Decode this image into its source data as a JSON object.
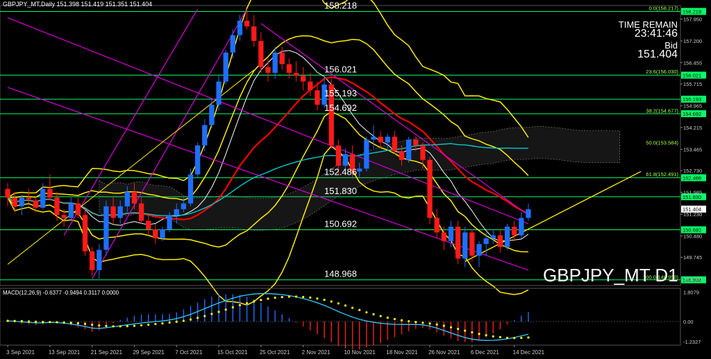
{
  "header": {
    "ohlc_text": "GBPJPY_MT,Daily  151.398 151.419 151.351 151.404"
  },
  "info": {
    "time_remain_label": "TIME REMAIN",
    "time_remain": "23:41:46",
    "bid_label": "Bid",
    "bid_value": "151.404"
  },
  "symbol_label": "GBPJPY_MT D1",
  "colors": {
    "bull": "#1e6fff",
    "bear": "#ff1a1a",
    "level": "#00ff66",
    "bollinger": "#ffee00",
    "channel": "#cc00cc",
    "ma_red": "#ff0000",
    "ma_cyan": "#00cccc",
    "fib_text": "#a6ff4d",
    "macd_signal": "#ffff00",
    "macd_line": "#33ccff"
  },
  "chart_data": {
    "type": "candlestick",
    "price_range": [
      148.77,
      158.42
    ],
    "y_ticks": [
      "157.950",
      "157.200",
      "156.455",
      "155.715",
      "154.965",
      "154.215",
      "153.465",
      "152.730",
      "151.985",
      "151.230",
      "150.480",
      "149.745",
      "149.000"
    ],
    "x_ticks": [
      "3 Sep 2021",
      "13 Sep 2021",
      "21 Sep 2021",
      "29 Sep 2021",
      "7 Oct 2021",
      "15 Oct 2021",
      "25 Oct 2021",
      "2 Nov 2021",
      "10 Nov 2021",
      "18 Nov 2021",
      "26 Nov 2021",
      "6 Dec 2021",
      "14 Dec 2021"
    ],
    "horizontal_levels": [
      {
        "value": 158.218,
        "label": "158.218",
        "axis_label": "158.218"
      },
      {
        "value": 156.021,
        "label": "156.021",
        "axis_label": "156.021"
      },
      {
        "value": 155.193,
        "label": "155.193",
        "axis_label": "155.193"
      },
      {
        "value": 154.692,
        "label": "154.692",
        "axis_label": "154.692"
      },
      {
        "value": 152.486,
        "label": "152.486",
        "axis_label": "152.486"
      },
      {
        "value": 151.83,
        "label": "151.830",
        "axis_label": "151.830"
      },
      {
        "value": 150.692,
        "label": "150.692",
        "axis_label": "150.692"
      },
      {
        "value": 148.968,
        "label": "148.968",
        "axis_label": "148.968"
      }
    ],
    "fib_levels": [
      {
        "value": 158.217,
        "label": "0.0(158.217)"
      },
      {
        "value": 156.03,
        "label": "23.6(156.030)"
      },
      {
        "value": 154.677,
        "label": "38.2(154.677)"
      },
      {
        "value": 153.584,
        "label": "50.0(153.584)"
      },
      {
        "value": 152.491,
        "label": "61.8(152.491)"
      },
      {
        "value": 148.95,
        "label": "100.0(148.950)"
      }
    ],
    "last_price": 151.404,
    "last_price_label": "151.404",
    "candles": [
      [
        152.1,
        152.3,
        151.5,
        151.8
      ],
      [
        151.8,
        152.0,
        151.3,
        151.5
      ],
      [
        151.5,
        151.9,
        151.2,
        151.8
      ],
      [
        151.8,
        152.1,
        151.6,
        151.75
      ],
      [
        151.7,
        151.85,
        151.3,
        151.45
      ],
      [
        151.45,
        152.3,
        151.4,
        152.1
      ],
      [
        152.1,
        152.6,
        151.7,
        151.8
      ],
      [
        151.8,
        152.0,
        151.0,
        151.2
      ],
      [
        151.2,
        151.4,
        150.8,
        151.1
      ],
      [
        151.1,
        151.8,
        151.0,
        151.6
      ],
      [
        151.6,
        151.8,
        151.1,
        151.2
      ],
      [
        151.2,
        151.4,
        149.8,
        149.95
      ],
      [
        149.95,
        150.1,
        149.1,
        149.3
      ],
      [
        149.3,
        150.2,
        149.0,
        150.0
      ],
      [
        150.0,
        151.7,
        149.8,
        151.5
      ],
      [
        151.5,
        151.8,
        150.9,
        151.1
      ],
      [
        151.1,
        151.7,
        150.9,
        151.5
      ],
      [
        151.5,
        152.2,
        151.3,
        152.0
      ],
      [
        152.0,
        152.3,
        151.4,
        151.6
      ],
      [
        151.6,
        151.8,
        150.9,
        151.0
      ],
      [
        151.0,
        151.2,
        150.5,
        150.7
      ],
      [
        150.7,
        150.9,
        150.2,
        150.4
      ],
      [
        150.4,
        150.8,
        150.3,
        150.7
      ],
      [
        150.7,
        151.3,
        150.6,
        151.2
      ],
      [
        151.2,
        151.6,
        150.9,
        151.4
      ],
      [
        151.4,
        151.8,
        151.3,
        151.6
      ],
      [
        151.6,
        152.8,
        151.5,
        152.6
      ],
      [
        152.6,
        153.7,
        152.5,
        153.6
      ],
      [
        153.6,
        154.5,
        153.4,
        154.3
      ],
      [
        154.3,
        155.2,
        154.2,
        155.0
      ],
      [
        155.0,
        156.0,
        154.8,
        155.8
      ],
      [
        155.8,
        156.9,
        155.7,
        156.8
      ],
      [
        156.8,
        157.6,
        156.6,
        157.4
      ],
      [
        157.4,
        158.1,
        157.2,
        157.9
      ],
      [
        157.9,
        158.3,
        157.6,
        157.7
      ],
      [
        157.7,
        158.1,
        157.0,
        157.2
      ],
      [
        157.2,
        157.5,
        156.1,
        156.3
      ],
      [
        156.3,
        156.6,
        155.8,
        156.1
      ],
      [
        156.1,
        157.0,
        155.9,
        156.8
      ],
      [
        156.8,
        157.0,
        156.2,
        156.4
      ],
      [
        156.4,
        156.6,
        155.9,
        156.1
      ],
      [
        156.1,
        156.5,
        155.8,
        156.0
      ],
      [
        156.0,
        156.3,
        155.5,
        155.8
      ],
      [
        155.8,
        156.1,
        155.3,
        155.5
      ],
      [
        155.5,
        155.8,
        154.8,
        155.0
      ],
      [
        155.0,
        156.0,
        154.9,
        155.7
      ],
      [
        155.7,
        155.9,
        153.5,
        153.6
      ],
      [
        153.6,
        153.8,
        152.6,
        152.9
      ],
      [
        152.9,
        153.5,
        152.7,
        153.3
      ],
      [
        153.3,
        153.6,
        152.5,
        152.7
      ],
      [
        152.7,
        153.0,
        152.5,
        152.8
      ],
      [
        152.8,
        153.9,
        152.7,
        153.8
      ],
      [
        153.8,
        154.3,
        153.5,
        153.9
      ],
      [
        153.9,
        154.1,
        153.5,
        153.7
      ],
      [
        153.7,
        154.0,
        153.5,
        153.9
      ],
      [
        153.9,
        154.1,
        153.3,
        153.4
      ],
      [
        153.4,
        153.6,
        152.9,
        153.1
      ],
      [
        153.1,
        153.9,
        153.0,
        153.8
      ],
      [
        153.8,
        153.9,
        153.4,
        153.6
      ],
      [
        153.6,
        153.7,
        152.8,
        153.1
      ],
      [
        153.1,
        153.2,
        150.9,
        151.1
      ],
      [
        151.1,
        151.4,
        150.4,
        150.6
      ],
      [
        150.6,
        150.8,
        150.0,
        150.3
      ],
      [
        150.3,
        151.0,
        150.1,
        150.8
      ],
      [
        150.8,
        151.0,
        149.5,
        149.7
      ],
      [
        149.7,
        150.8,
        149.4,
        150.6
      ],
      [
        150.6,
        150.7,
        149.6,
        149.8
      ],
      [
        149.8,
        150.3,
        149.4,
        150.2
      ],
      [
        150.2,
        150.6,
        149.8,
        150.4
      ],
      [
        150.4,
        150.7,
        150.2,
        150.5
      ],
      [
        150.5,
        150.7,
        149.9,
        150.1
      ],
      [
        150.1,
        150.9,
        150.0,
        150.8
      ],
      [
        150.8,
        151.0,
        150.3,
        150.5
      ],
      [
        150.5,
        151.3,
        150.4,
        151.1
      ],
      [
        151.1,
        151.6,
        151.0,
        151.4
      ]
    ],
    "macd": {
      "title": "MACD(12,26,9) -0.6377 -0.9494 0.3117 0.0000",
      "range": [
        -1.45,
        2.05
      ],
      "y_ticks": [
        "1.8079",
        "0.00",
        "-1.2327"
      ],
      "line": [
        0.05,
        0.02,
        -0.02,
        -0.05,
        -0.08,
        -0.08,
        -0.05,
        -0.06,
        -0.1,
        -0.15,
        -0.22,
        -0.3,
        -0.4,
        -0.42,
        -0.38,
        -0.32,
        -0.26,
        -0.2,
        -0.14,
        -0.09,
        -0.04,
        0.0,
        0.04,
        0.1,
        0.18,
        0.3,
        0.45,
        0.62,
        0.8,
        0.98,
        1.15,
        1.3,
        1.44,
        1.56,
        1.64,
        1.7,
        1.72,
        1.72,
        1.7,
        1.66,
        1.6,
        1.52,
        1.42,
        1.3,
        1.16,
        1.0,
        0.82,
        0.62,
        0.44,
        0.28,
        0.14,
        0.04,
        -0.04,
        -0.1,
        -0.14,
        -0.17,
        -0.18,
        -0.18,
        -0.18,
        -0.2,
        -0.28,
        -0.4,
        -0.55,
        -0.7,
        -0.85,
        -0.98,
        -1.08,
        -1.14,
        -1.16,
        -1.15,
        -1.12,
        -1.06,
        -0.98,
        -0.88,
        -0.78
      ],
      "signal": [
        0.05,
        0.04,
        0.03,
        0.01,
        -0.01,
        -0.02,
        -0.03,
        -0.04,
        -0.05,
        -0.07,
        -0.1,
        -0.14,
        -0.19,
        -0.24,
        -0.27,
        -0.29,
        -0.29,
        -0.28,
        -0.26,
        -0.23,
        -0.19,
        -0.15,
        -0.11,
        -0.06,
        -0.01,
        0.05,
        0.13,
        0.23,
        0.34,
        0.47,
        0.6,
        0.74,
        0.88,
        1.01,
        1.13,
        1.24,
        1.33,
        1.41,
        1.47,
        1.51,
        1.53,
        1.54,
        1.52,
        1.48,
        1.42,
        1.34,
        1.24,
        1.12,
        0.99,
        0.85,
        0.71,
        0.57,
        0.45,
        0.34,
        0.24,
        0.15,
        0.08,
        0.02,
        -0.03,
        -0.07,
        -0.12,
        -0.18,
        -0.26,
        -0.35,
        -0.45,
        -0.56,
        -0.66,
        -0.76,
        -0.84,
        -0.91,
        -0.96,
        -1.0,
        -1.01,
        -1.0,
        -0.98
      ]
    }
  }
}
